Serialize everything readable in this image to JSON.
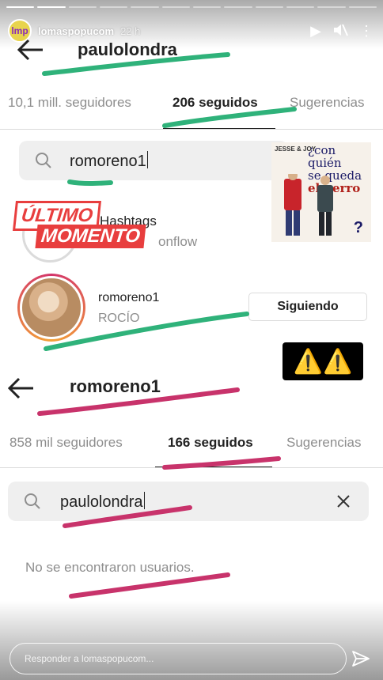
{
  "story": {
    "username": "lomaspopucom",
    "time": "22 h",
    "avatar_text": "lmp",
    "reply_placeholder": "Responder a lomaspopucom..."
  },
  "screen1": {
    "title": "paulolondra",
    "tabs": {
      "followers": "10,1 mill. seguidores",
      "following": "206 seguidos",
      "suggestions": "Sugerencias"
    },
    "search_value": "romoreno1",
    "hashtag_title": "Hashtags",
    "hashtag_sub": "onflow",
    "user": {
      "username": "romoreno1",
      "full_name": "ROCÍO",
      "button": "Siguiendo"
    }
  },
  "stickers": {
    "breaking_line1": "ÚLTIMO",
    "breaking_line2": "MOMENTO",
    "warning": "⚠️⚠️",
    "book_brand": "JESSE & JOY",
    "book_title_1": "¿con quién",
    "book_title_2": "se queda",
    "book_title_3": "el perro",
    "book_q": "?"
  },
  "screen2": {
    "title": "romoreno1",
    "tabs": {
      "followers": "858 mil seguidores",
      "following": "166 seguidos",
      "suggestions": "Sugerencias"
    },
    "search_value": "paulolondra",
    "empty_text": "No se encontraron usuarios."
  },
  "colors": {
    "marker_green": "#2fb27a",
    "marker_pink": "#c8336b",
    "sticker_red": "#e83e3e"
  }
}
